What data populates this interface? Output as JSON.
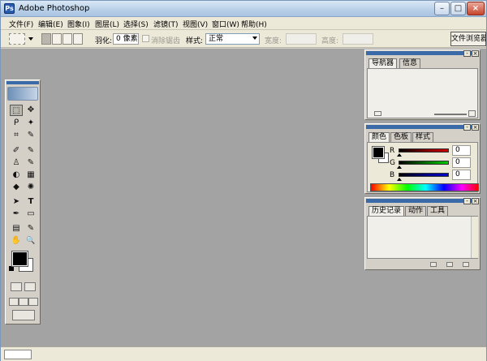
{
  "window": {
    "title": "Adobe Photoshop",
    "app_icon": "Ps",
    "controls": {
      "minimize": "–",
      "maximize": "□",
      "close": "×"
    }
  },
  "menu": [
    "文件(F)",
    "编辑(E)",
    "图象(I)",
    "图层(L)",
    "选择(S)",
    "滤镜(T)",
    "视图(V)",
    "窗口(W)",
    "帮助(H)"
  ],
  "options": {
    "feather_label": "羽化:",
    "feather_value": "0 像素",
    "antialias_label": "消除锯齿",
    "style_label": "样式:",
    "style_value": "正常",
    "width_label": "宽度:",
    "height_label": "高度:",
    "file_browser_label": "文件浏览器"
  },
  "toolbox": {
    "tools": [
      "⬚",
      "✥",
      "ᑭ",
      "✦",
      "⌗",
      "✎",
      "✐",
      "✎",
      "♙",
      "✎",
      "◐",
      "▦",
      "◆",
      "✺",
      "➤",
      "T",
      "✒",
      "▭",
      "▤",
      "✎",
      "✋",
      "🔍"
    ]
  },
  "navigator": {
    "tabs": [
      "导航器",
      "信息"
    ]
  },
  "color": {
    "tabs": [
      "颜色",
      "色板",
      "样式"
    ],
    "channels": [
      {
        "label": "R",
        "value": "0",
        "color": "#8b0000"
      },
      {
        "label": "G",
        "value": "0",
        "color": "#007a00"
      },
      {
        "label": "B",
        "value": "0",
        "color": "#00008b"
      }
    ]
  },
  "history": {
    "tabs": [
      "历史记录",
      "动作",
      "工具"
    ]
  },
  "colors": {
    "workspace": "#a3a3a3",
    "palette_header": "#3b6aa9"
  }
}
